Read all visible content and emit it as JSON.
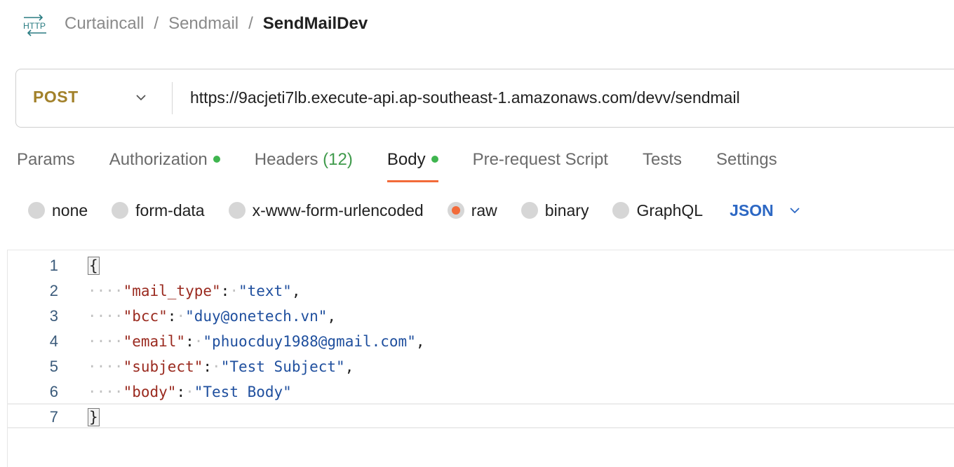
{
  "header": {
    "icon": "http-icon",
    "icon_label": "HTTP",
    "breadcrumb": [
      "Curtaincall",
      "Sendmail",
      "SendMailDev"
    ],
    "separator": "/"
  },
  "request": {
    "method": "POST",
    "url": "https://9acjeti7lb.execute-api.ap-southeast-1.amazonaws.com/devv/sendmail"
  },
  "tabs": [
    {
      "label": "Params"
    },
    {
      "label": "Authorization",
      "dot": true
    },
    {
      "label": "Headers",
      "count": "(12)"
    },
    {
      "label": "Body",
      "dot": true,
      "active": true
    },
    {
      "label": "Pre-request Script"
    },
    {
      "label": "Tests"
    },
    {
      "label": "Settings"
    }
  ],
  "body_types": [
    {
      "label": "none",
      "checked": false
    },
    {
      "label": "form-data",
      "checked": false
    },
    {
      "label": "x-www-form-urlencoded",
      "checked": false
    },
    {
      "label": "raw",
      "checked": true
    },
    {
      "label": "binary",
      "checked": false
    },
    {
      "label": "GraphQL",
      "checked": false
    }
  ],
  "language": "JSON",
  "editor": {
    "lines": [
      {
        "n": "1",
        "open": "{"
      },
      {
        "n": "2",
        "key": "\"mail_type\"",
        "value": "\"text\"",
        "trail": ","
      },
      {
        "n": "3",
        "key": "\"bcc\"",
        "value": "\"duy@onetech.vn\"",
        "trail": ","
      },
      {
        "n": "4",
        "key": "\"email\"",
        "value": "\"phuocduy1988@gmail.com\"",
        "trail": ","
      },
      {
        "n": "5",
        "key": "\"subject\"",
        "value": "\"Test Subject\"",
        "trail": ","
      },
      {
        "n": "6",
        "key": "\"body\"",
        "value": "\"Test Body\"",
        "trail": ""
      },
      {
        "n": "7",
        "close": "}"
      }
    ]
  },
  "colors": {
    "method": "#a2812a",
    "active_tab_underline": "#f26b3a",
    "status_dot": "#3fb54f",
    "json_key": "#9a2a1f",
    "json_string": "#1f4f9e",
    "language_link": "#2d68c4"
  }
}
